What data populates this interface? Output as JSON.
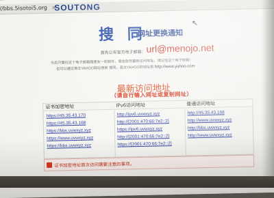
{
  "browser": {
    "url": "//bbs.5isotoi5.org",
    "tab_close": "×"
  },
  "logo": "SOUTONG",
  "title": "搜 同",
  "subtitle": "网址更换通知",
  "email_label": "首先公布官方电子邮箱：",
  "email": "url@menojo.net",
  "notice_line1": "今后只需往这个电子邮箱随便发一封邮件，便会收到最新访问地址。请记住这个电子邮箱！",
  "notice_line2": "也可以通过英文YAHOO网站搜索 搜同，英文YAHOO的地址是",
  "yahoo_url": "http://www.yahoo.com",
  "latest_heading": "最新访问地址",
  "manual_note": "（请自行输入网址或复制网址）",
  "columns": [
    {
      "header": "证书加密地址",
      "links": [
        "https://45.35.43.170",
        "https://45.35.43.168",
        "https://bbs.uvwxyz.xyz",
        "https://www.uvwxyz.xyz",
        "https://bbs.uvwxyz.xyz"
      ]
    },
    {
      "header": "IPv6访问地址",
      "links": [
        "http://ipv6.uvwxyz.xyz",
        "http://[2001:470:66:7e2::2]",
        "https://ipv6.uvwxyz.xyz",
        "http://[2001:470:66:7e2::2]",
        "https://[2001:470:66:7e2::2]"
      ]
    },
    {
      "header": "普通访问地址",
      "links": [
        "http://45.35.43.168",
        "http://www.uvwxyz.xyz",
        "http://bbs.uvwxyz.xyz",
        "http://www.uvwxyz.xyz"
      ]
    }
  ],
  "warning": "证书加密地址首次访问需要注意的事项。"
}
